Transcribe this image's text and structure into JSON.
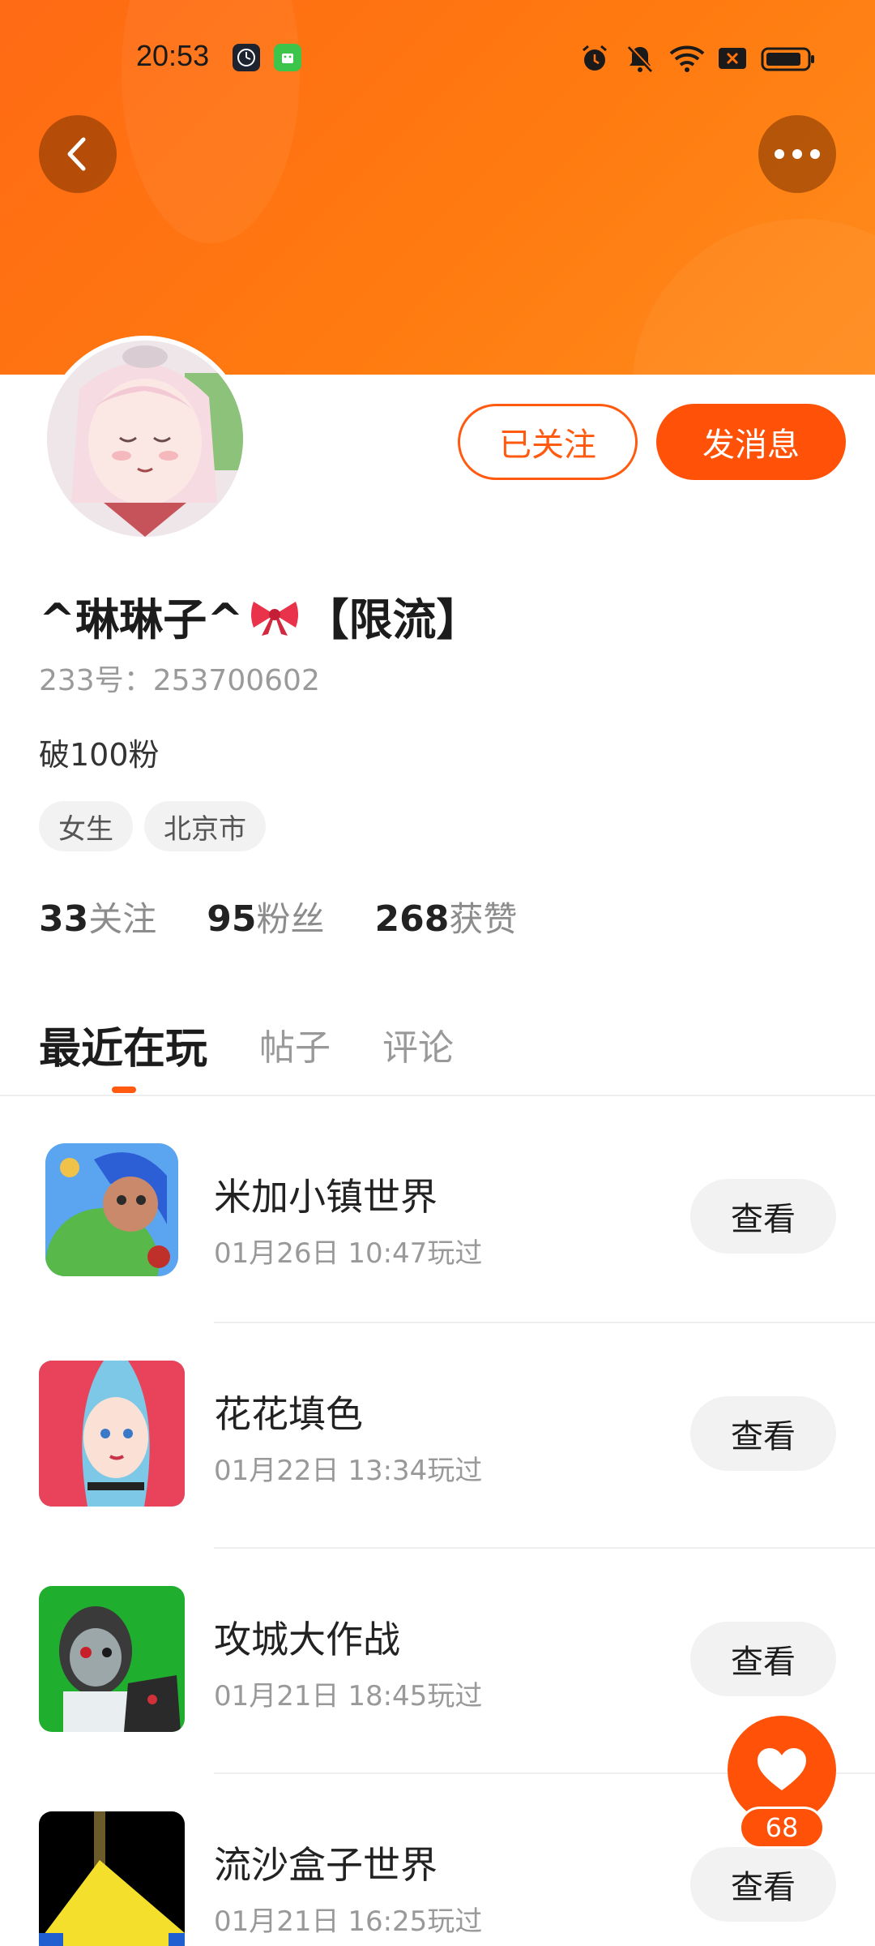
{
  "status_bar": {
    "time": "20:53",
    "icons": [
      "clock-app-icon",
      "android-app-icon",
      "alarm-icon",
      "mute-icon",
      "wifi-icon",
      "sim-off-icon",
      "battery-icon"
    ]
  },
  "header": {
    "back_icon": "chevron-left-icon",
    "more_icon": "more-dots-icon",
    "banner_color": "#ff7410"
  },
  "profile": {
    "follow_label": "已关注",
    "message_label": "发消息",
    "username_prefix": "^琳琳子^",
    "username_suffix": "【限流】",
    "user_id": "233号：253700602",
    "bio": "破100粉",
    "tags": [
      "女生",
      "北京市"
    ],
    "stats": [
      {
        "num": "33",
        "label": "关注"
      },
      {
        "num": "95",
        "label": "粉丝"
      },
      {
        "num": "268",
        "label": "获赞"
      }
    ]
  },
  "tabs": [
    "最近在玩",
    "帖子",
    "评论"
  ],
  "games": [
    {
      "name": "米加小镇世界",
      "time": "01月26日 10:47玩过",
      "button": "查看"
    },
    {
      "name": "花花填色",
      "time": "01月22日 13:34玩过",
      "button": "查看"
    },
    {
      "name": "攻城大作战",
      "time": "01月21日 18:45玩过",
      "button": "查看"
    },
    {
      "name": "流沙盒子世界",
      "time": "01月21日 16:25玩过",
      "button": "查看"
    }
  ],
  "like": {
    "count": "68"
  },
  "accent_color": "#ff5208"
}
